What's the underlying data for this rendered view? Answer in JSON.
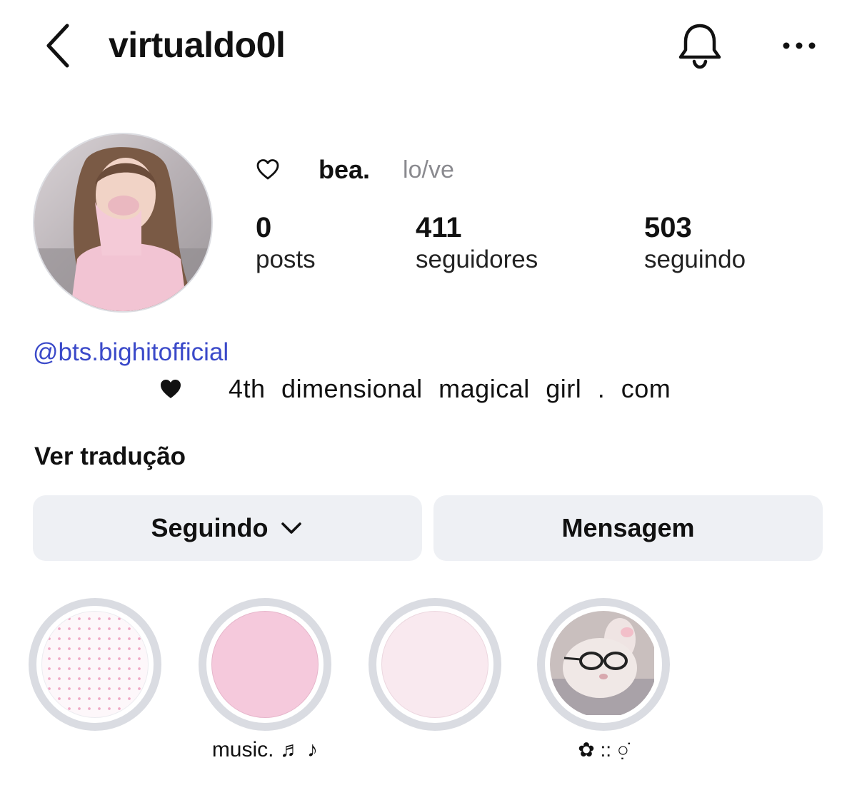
{
  "header": {
    "username": "virtualdo0l"
  },
  "profile": {
    "display_name": "bea.",
    "pronouns": "lo/ve",
    "stats": [
      {
        "value": "0",
        "label": "posts"
      },
      {
        "value": "411",
        "label": "seguidores"
      },
      {
        "value": "503",
        "label": "seguindo"
      }
    ]
  },
  "bio": {
    "link": "@bts.bighitofficial",
    "text": "4th  dimensional  magical  girl  .  com",
    "translate_label": "Ver tradução"
  },
  "actions": {
    "following_label": "Seguindo",
    "message_label": "Mensagem"
  },
  "highlights": [
    {
      "label": ""
    },
    {
      "label": "music.   ♬  ♪"
    },
    {
      "label": ""
    },
    {
      "label": "✿ :: ○̣̇"
    }
  ],
  "colors": {
    "link": "#3a49c9",
    "button_bg": "#eef0f4",
    "highlight_ring": "#dadce2",
    "highlight_pink": "#f5c9dc",
    "highlight_light_pink": "#f9e9ef"
  },
  "icons": {
    "back": "chevron-left-icon",
    "notifications": "bell-icon",
    "more": "more-horizontal-icon",
    "name_prefix": "heart-outline-icon",
    "bio_prefix": "heart-filled-icon",
    "following_dropdown": "chevron-down-icon"
  }
}
